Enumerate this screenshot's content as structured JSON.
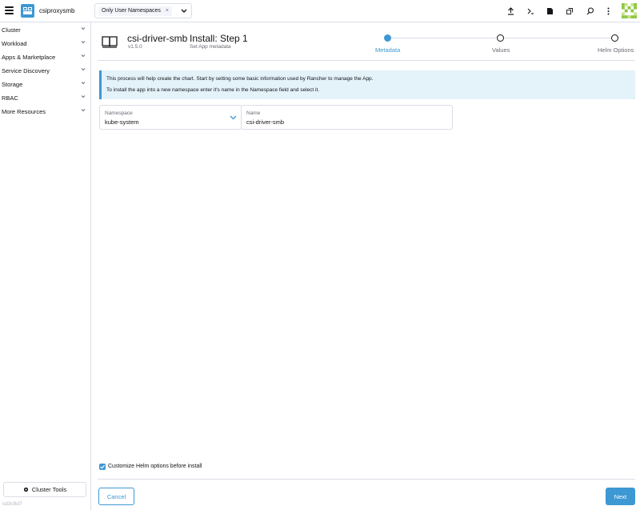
{
  "header": {
    "cluster_name": "csiproxysmb",
    "namespace_filter": "Only User Namespaces",
    "namespace_remove": "×",
    "icons": [
      "upload-icon",
      "terminal-icon",
      "file-icon",
      "copy-icon",
      "search-icon",
      "more-icon"
    ]
  },
  "sidebar": {
    "items": [
      {
        "label": "Cluster"
      },
      {
        "label": "Workload"
      },
      {
        "label": "Apps & Marketplace"
      },
      {
        "label": "Service Discovery"
      },
      {
        "label": "Storage"
      },
      {
        "label": "RBAC"
      },
      {
        "label": "More Resources"
      }
    ],
    "cluster_tools_label": "Cluster Tools",
    "version": "cd3c9d7"
  },
  "main": {
    "chart_name": "csi-driver-smb",
    "chart_version": "v1.5.0",
    "step_title": "Install: Step 1",
    "step_subtitle": "Set App metadata",
    "steps": [
      {
        "label": "Metadata",
        "active": true
      },
      {
        "label": "Values",
        "active": false
      },
      {
        "label": "Helm Options",
        "active": false
      }
    ],
    "banner": {
      "line1": "This process will help create the chart. Start by setting some basic information used by Rancher to manage the App.",
      "line2": "To install the app into a new namespace enter it's name in the Namespace field and select it."
    },
    "namespace_field": {
      "label": "Namespace",
      "value": "kube-system"
    },
    "name_field": {
      "label": "Name",
      "value": "csi-driver-smb"
    },
    "customize_helm_label": "Customize Helm options before install",
    "customize_helm_checked": true,
    "cancel_label": "Cancel",
    "next_label": "Next"
  },
  "colors": {
    "primary": "#3d98d3",
    "banner_bg": "#e4f2fa",
    "border": "#dcdee7",
    "muted_text": "#6c6c76",
    "avatar_green": "#8dc63f"
  }
}
